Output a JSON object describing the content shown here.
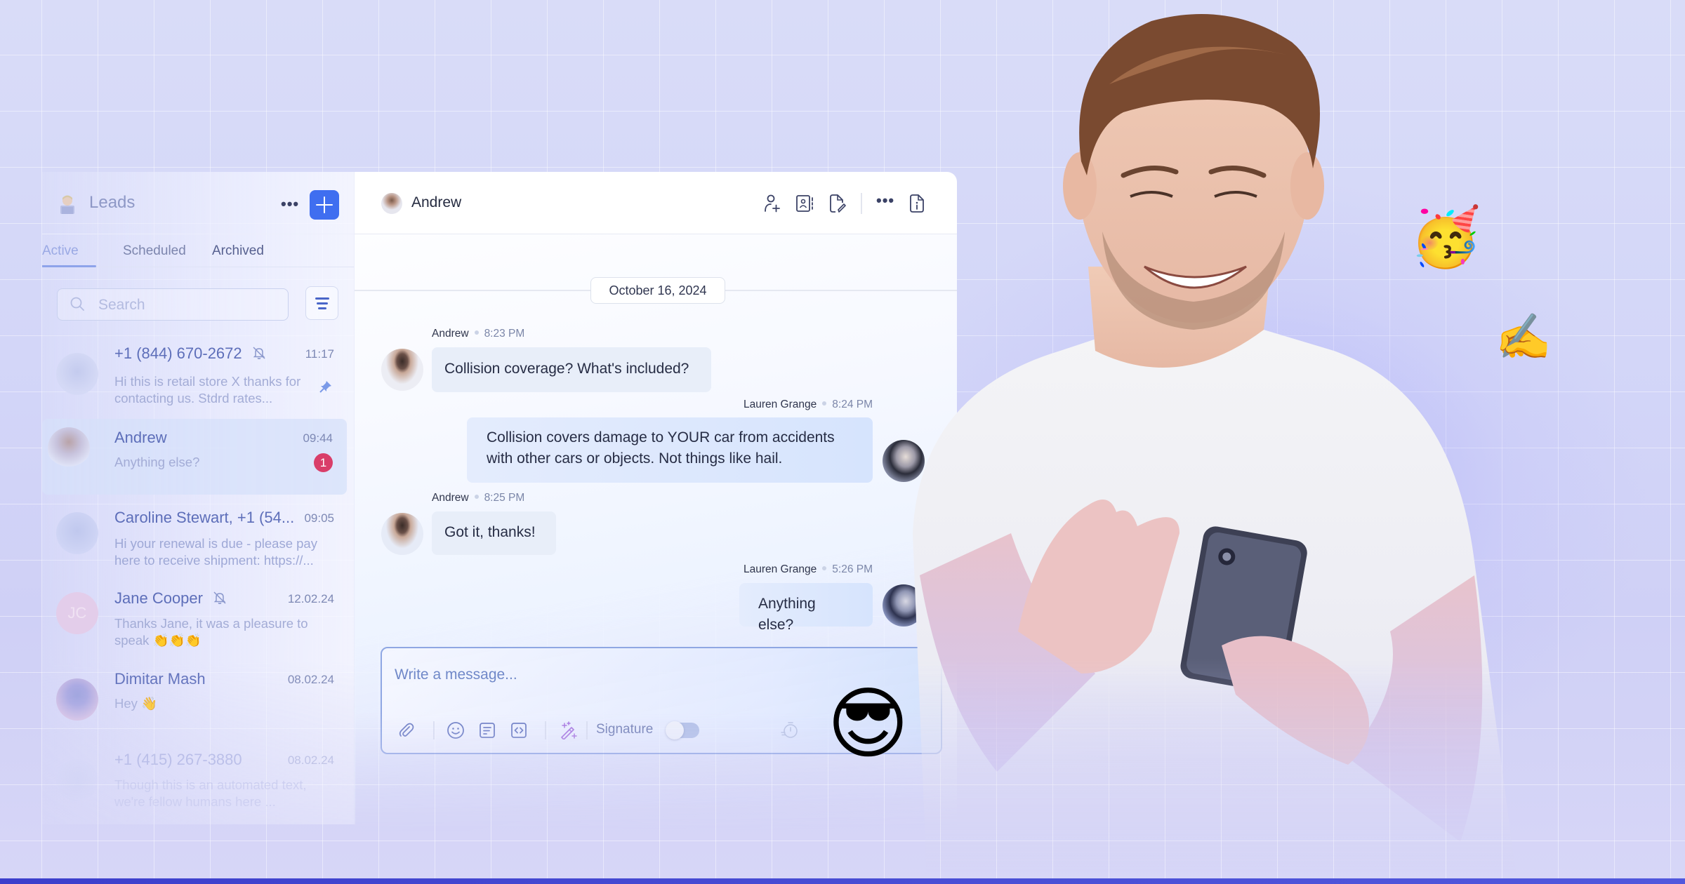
{
  "colors": {
    "accent": "#3f6ef0",
    "unread_badge": "#d93e69",
    "bottom_bar": "#4248d2",
    "background": "#d5d8f8"
  },
  "leads_panel": {
    "title": "Leads",
    "logo_icon": "person-at-laptop-emoji",
    "more_label": "•••",
    "add_icon": "plus-icon",
    "tabs": [
      {
        "label": "Active",
        "active": true
      },
      {
        "label": "Scheduled",
        "active": false
      },
      {
        "label": "Archived",
        "active": false
      }
    ],
    "search": {
      "placeholder": "Search",
      "value": ""
    },
    "filter_icon": "filter-lines-icon",
    "items": [
      {
        "name": "+1 (844) 670-2672",
        "muted": true,
        "time": "11:17",
        "preview": "Hi this is retail store X thanks for contacting us. Stdrd rates...",
        "pinned": true,
        "selected": false
      },
      {
        "name": "Andrew",
        "muted": false,
        "time": "09:44",
        "preview": "Anything else?",
        "unread": "1",
        "selected": true
      },
      {
        "name": "Caroline Stewart, +1 (54...",
        "muted": false,
        "time": "09:05",
        "preview": "Hi your renewal is due - please pay here to receive shipment: https://...",
        "selected": false
      },
      {
        "name": "Jane Cooper",
        "muted": true,
        "time": "12.02.24",
        "preview": "Thanks Jane, it was a pleasure to speak 👏👏👏",
        "avatar_initials": "JC",
        "selected": false
      },
      {
        "name": "Dimitar Mash",
        "muted": false,
        "time": "08.02.24",
        "preview": "Hey 👋",
        "selected": false
      },
      {
        "name": "+1 (415) 267-3880",
        "muted": false,
        "time": "08.02.24",
        "preview": "Though this is an automated text, we're fellow humans here ...",
        "selected": false
      }
    ]
  },
  "chat": {
    "contact_name": "Andrew",
    "header_actions": [
      {
        "icon": "add-user-icon"
      },
      {
        "icon": "contact-book-icon"
      },
      {
        "icon": "file-edit-icon"
      },
      {
        "icon": "more-icon",
        "label": "•••"
      },
      {
        "icon": "file-info-icon"
      }
    ],
    "date_divider": "October 16, 2024",
    "messages": [
      {
        "sender": "Andrew",
        "time": "8:23 PM",
        "text": "Collision coverage? What's included?",
        "direction": "in"
      },
      {
        "sender": "Lauren Grange",
        "time": "8:24 PM",
        "text": "Collision covers damage to YOUR car from accidents with other cars or objects. Not things like hail.",
        "direction": "out"
      },
      {
        "sender": "Andrew",
        "time": "8:25 PM",
        "text": "Got it, thanks!",
        "direction": "in"
      },
      {
        "sender": "Lauren Grange",
        "time": "5:26 PM",
        "text": "Anything else?",
        "direction": "out"
      }
    ],
    "composer": {
      "placeholder": "Write a message...",
      "value": "",
      "tools": [
        "paperclip-icon",
        "smiley-icon",
        "template-icon",
        "code-icon",
        "magic-wand-icon"
      ],
      "signature_label": "Signature",
      "signature_enabled": false,
      "schedule_icon": "timer-icon"
    }
  },
  "decorations": {
    "sunglasses_emoji": "😎",
    "party_emoji": "🥳",
    "writing_hand_emoji": "✍️"
  }
}
